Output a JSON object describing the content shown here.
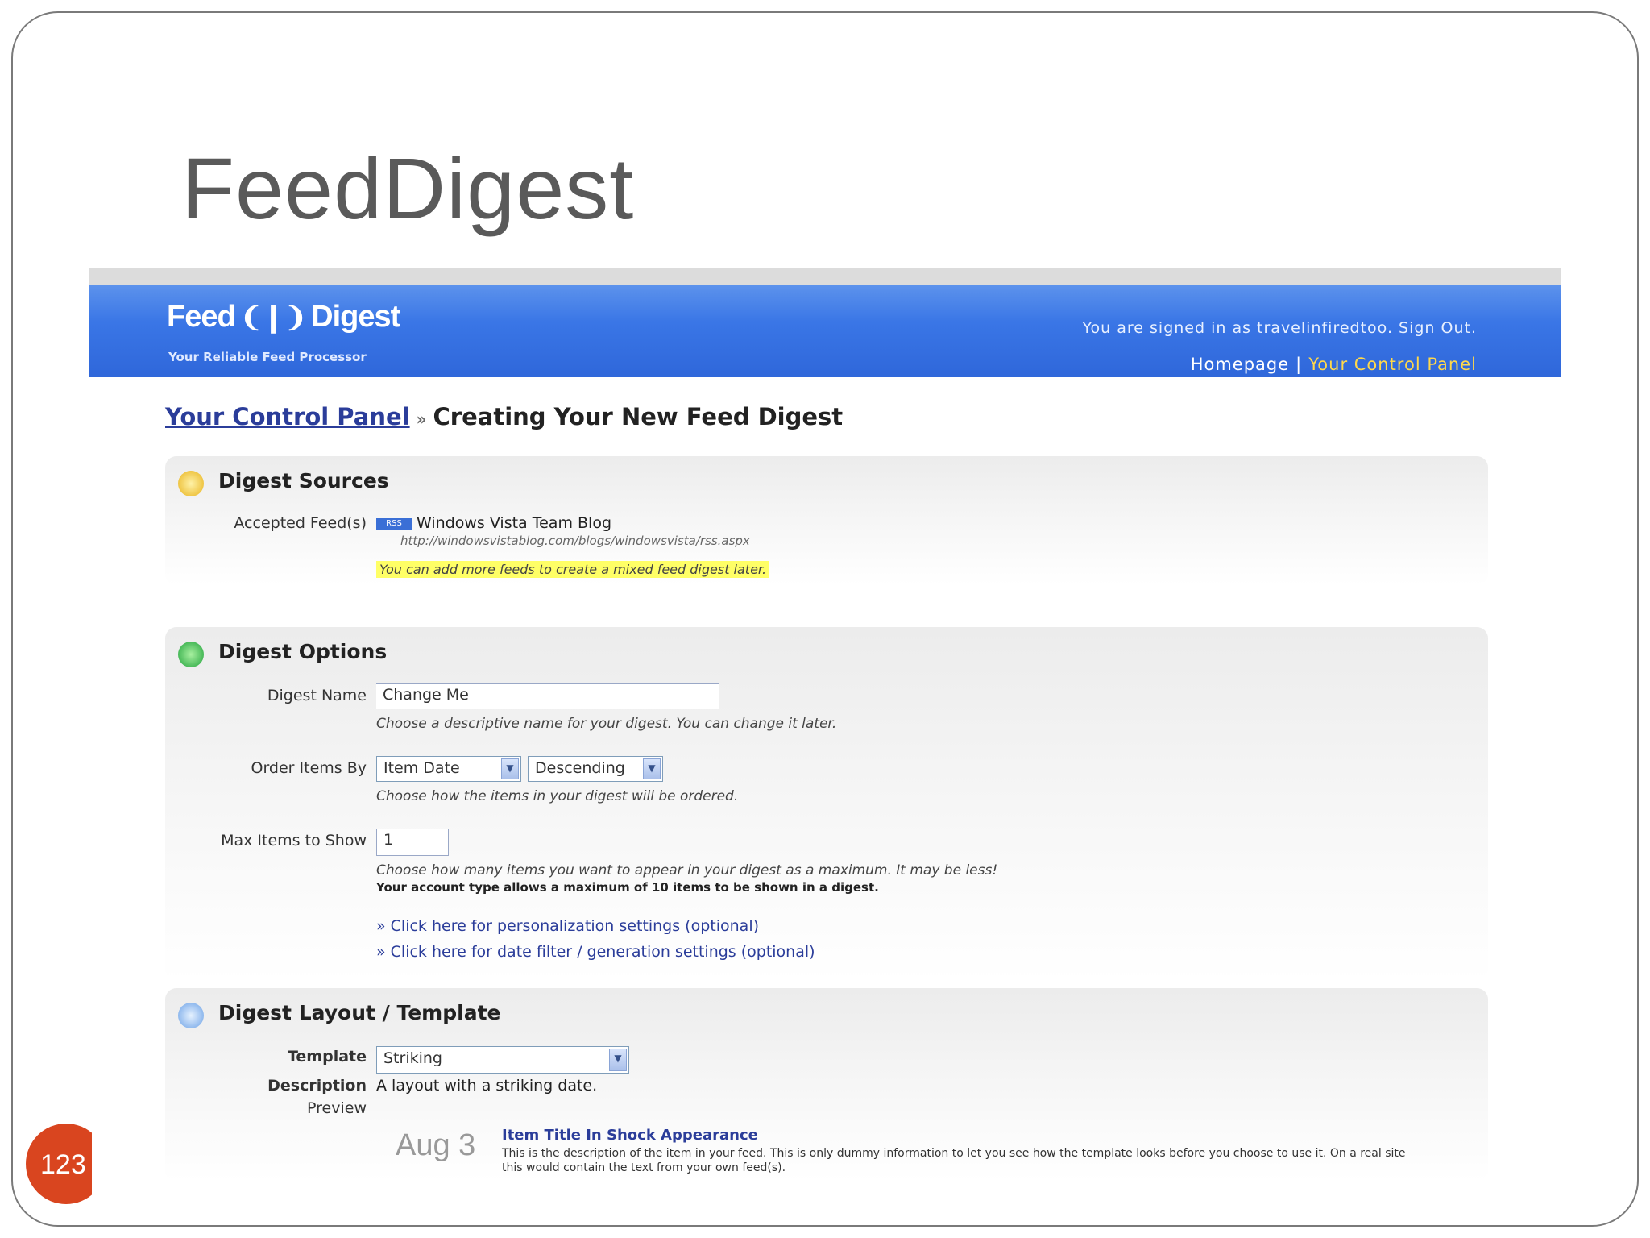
{
  "slide": {
    "title": "FeedDigest",
    "page_number": "123"
  },
  "header": {
    "logo_left": "Feed",
    "logo_right": "Digest",
    "tagline": "Your Reliable Feed Processor",
    "signed_in": "You are signed in as travelinfiredtoo. Sign Out.",
    "nav_home": "Homepage",
    "nav_sep": "|",
    "nav_control_panel": "Your Control Panel"
  },
  "breadcrumb": {
    "link": "Your Control Panel",
    "sep": "»",
    "current": "Creating Your New Feed Digest"
  },
  "sources": {
    "title": "Digest Sources",
    "accepted_label": "Accepted Feed(s)",
    "rss_badge": "RSS",
    "feed_name": "Windows Vista Team Blog",
    "feed_url": "http://windowsvistablog.com/blogs/windowsvista/rss.aspx",
    "notice": "You can add more feeds to create a mixed feed digest later."
  },
  "options": {
    "title": "Digest Options",
    "name_label": "Digest Name",
    "name_value": "Change Me",
    "name_hint": "Choose a descriptive name for your digest. You can change it later.",
    "order_label": "Order Items By",
    "order_field": "Item Date",
    "order_dir": "Descending",
    "order_hint": "Choose how the items in your digest will be ordered.",
    "max_label": "Max Items to Show",
    "max_value": "1",
    "max_hint": "Choose how many items you want to appear in your digest as a maximum. It may be less!",
    "max_note": "Your account type allows a maximum of 10 items to be shown in a digest.",
    "link_personalization": "» Click here for personalization settings (optional)",
    "link_filter": "» Click here for date filter / generation settings (optional)"
  },
  "layout": {
    "title": "Digest Layout / Template",
    "template_label": "Template",
    "template_value": "Striking",
    "desc_label": "Description",
    "desc_value": "A layout with a striking date.",
    "preview_label": "Preview",
    "preview_date": "Aug 3",
    "preview_item_title": "Item Title In Shock Appearance",
    "preview_item_text": "This is the description of the item in your feed. This is only dummy information to let you see how the template looks before you choose to use it. On a real site this would contain the text from your own feed(s)."
  },
  "colors": {
    "header_blue": "#3a76e6",
    "nav_yellow": "#ffd84a",
    "highlight": "#ffff66",
    "badge": "#d9451f"
  }
}
